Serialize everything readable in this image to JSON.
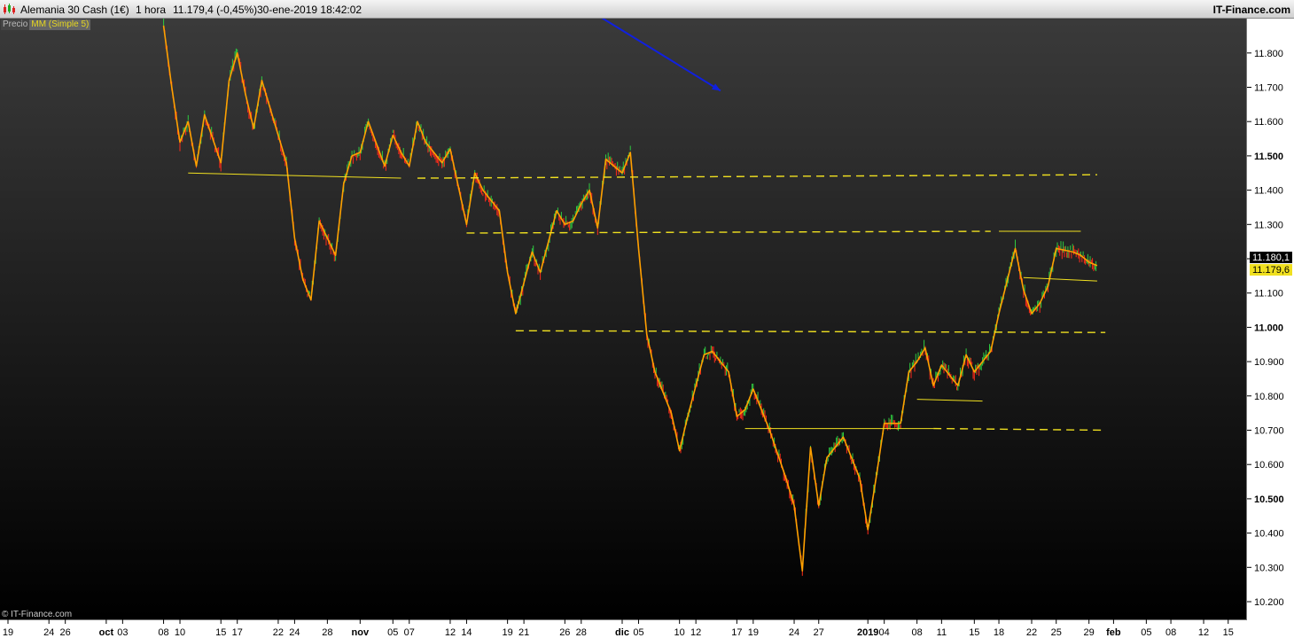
{
  "window": {
    "instrument": "Alemania 30 Cash (1€)",
    "timeframe": "1 hora",
    "last_change": "11.179,4 (-0,45%)",
    "datetime": "30-ene-2019 18:42:02",
    "brand": "IT-Finance.com"
  },
  "legend": {
    "price_label": "Precio",
    "ma_label": "MM (Simple 5)"
  },
  "copyright": "© IT-Finance.com",
  "colors": {
    "up": "#2ecc40",
    "down": "#ff2a1a",
    "ma": "#ffa000",
    "level": "#f0e020",
    "arrow": "#1020e0"
  },
  "chart_data": {
    "type": "line",
    "instrument": "Alemania 30 Cash (1€)",
    "interval": "1 hora",
    "ylim": [
      10170,
      11910
    ],
    "y_ticks": [
      10200,
      10300,
      10400,
      10500,
      10600,
      10700,
      10800,
      10900,
      11000,
      11100,
      11200,
      11300,
      11400,
      11500,
      11600,
      11700,
      11800
    ],
    "y_tick_labels": [
      "10.200",
      "10.300",
      "10.400",
      "10.500",
      "10.600",
      "10.700",
      "10.800",
      "10.900",
      "11.000",
      "11.100",
      "11.200",
      "11.300",
      "11.400",
      "11.500",
      "11.600",
      "11.700",
      "11.800"
    ],
    "y_major_ticks": [
      "10.500",
      "11.000",
      "11.500"
    ],
    "x_range": [
      "2018-09-19",
      "2019-02-16"
    ],
    "x_tick_labels": [
      {
        "date": "2018-09-19",
        "label": "19"
      },
      {
        "date": "2018-09-24",
        "label": "24"
      },
      {
        "date": "2018-09-26",
        "label": "26"
      },
      {
        "date": "2018-10-01",
        "label": "oct"
      },
      {
        "date": "2018-10-03",
        "label": "03"
      },
      {
        "date": "2018-10-08",
        "label": "08"
      },
      {
        "date": "2018-10-10",
        "label": "10"
      },
      {
        "date": "2018-10-15",
        "label": "15"
      },
      {
        "date": "2018-10-17",
        "label": "17"
      },
      {
        "date": "2018-10-22",
        "label": "22"
      },
      {
        "date": "2018-10-24",
        "label": "24"
      },
      {
        "date": "2018-10-28",
        "label": "28"
      },
      {
        "date": "2018-11-01",
        "label": "nov"
      },
      {
        "date": "2018-11-05",
        "label": "05"
      },
      {
        "date": "2018-11-07",
        "label": "07"
      },
      {
        "date": "2018-11-12",
        "label": "12"
      },
      {
        "date": "2018-11-14",
        "label": "14"
      },
      {
        "date": "2018-11-19",
        "label": "19"
      },
      {
        "date": "2018-11-21",
        "label": "21"
      },
      {
        "date": "2018-11-26",
        "label": "26"
      },
      {
        "date": "2018-11-28",
        "label": "28"
      },
      {
        "date": "2018-12-03",
        "label": "dic"
      },
      {
        "date": "2018-12-05",
        "label": "05"
      },
      {
        "date": "2018-12-10",
        "label": "10"
      },
      {
        "date": "2018-12-12",
        "label": "12"
      },
      {
        "date": "2018-12-17",
        "label": "17"
      },
      {
        "date": "2018-12-19",
        "label": "19"
      },
      {
        "date": "2018-12-24",
        "label": "24"
      },
      {
        "date": "2018-12-27",
        "label": "27"
      },
      {
        "date": "2019-01-02",
        "label": "2019"
      },
      {
        "date": "2019-01-04",
        "label": "04"
      },
      {
        "date": "2019-01-08",
        "label": "08"
      },
      {
        "date": "2019-01-11",
        "label": "11"
      },
      {
        "date": "2019-01-15",
        "label": "15"
      },
      {
        "date": "2019-01-18",
        "label": "18"
      },
      {
        "date": "2019-01-22",
        "label": "22"
      },
      {
        "date": "2019-01-25",
        "label": "25"
      },
      {
        "date": "2019-01-29",
        "label": "29"
      },
      {
        "date": "2019-02-01",
        "label": "feb"
      },
      {
        "date": "2019-02-05",
        "label": "05"
      },
      {
        "date": "2019-02-08",
        "label": "08"
      },
      {
        "date": "2019-02-12",
        "label": "12"
      },
      {
        "date": "2019-02-15",
        "label": "15"
      }
    ],
    "series": [
      {
        "name": "MM (Simple 5)",
        "x": [
          "2018-10-08",
          "2018-10-09",
          "2018-10-10",
          "2018-10-11",
          "2018-10-12",
          "2018-10-13",
          "2018-10-15",
          "2018-10-16",
          "2018-10-17",
          "2018-10-18",
          "2018-10-19",
          "2018-10-20",
          "2018-10-22",
          "2018-10-23",
          "2018-10-24",
          "2018-10-25",
          "2018-10-26",
          "2018-10-27",
          "2018-10-29",
          "2018-10-30",
          "2018-10-31",
          "2018-11-01",
          "2018-11-02",
          "2018-11-04",
          "2018-11-05",
          "2018-11-06",
          "2018-11-07",
          "2018-11-08",
          "2018-11-09",
          "2018-11-11",
          "2018-11-12",
          "2018-11-13",
          "2018-11-14",
          "2018-11-15",
          "2018-11-16",
          "2018-11-18",
          "2018-11-19",
          "2018-11-20",
          "2018-11-21",
          "2018-11-22",
          "2018-11-23",
          "2018-11-25",
          "2018-11-26",
          "2018-11-27",
          "2018-11-28",
          "2018-11-29",
          "2018-11-30",
          "2018-12-01",
          "2018-12-03",
          "2018-12-04",
          "2018-12-05",
          "2018-12-06",
          "2018-12-07",
          "2018-12-09",
          "2018-12-10",
          "2018-12-11",
          "2018-12-12",
          "2018-12-13",
          "2018-12-14",
          "2018-12-16",
          "2018-12-17",
          "2018-12-18",
          "2018-12-19",
          "2018-12-20",
          "2018-12-21",
          "2018-12-23",
          "2018-12-24",
          "2018-12-25",
          "2018-12-26",
          "2018-12-27",
          "2018-12-28",
          "2018-12-30",
          "2019-01-01",
          "2019-01-02",
          "2019-01-03",
          "2019-01-04",
          "2019-01-06",
          "2019-01-07",
          "2019-01-08",
          "2019-01-09",
          "2019-01-10",
          "2019-01-11",
          "2019-01-13",
          "2019-01-14",
          "2019-01-15",
          "2019-01-16",
          "2019-01-17",
          "2019-01-18",
          "2019-01-20",
          "2019-01-21",
          "2019-01-22",
          "2019-01-23",
          "2019-01-24",
          "2019-01-25",
          "2019-01-27",
          "2019-01-28",
          "2019-01-29",
          "2019-01-30"
        ],
        "values": [
          11880,
          11700,
          11540,
          11600,
          11470,
          11620,
          11480,
          11720,
          11800,
          11680,
          11580,
          11720,
          11560,
          11480,
          11260,
          11140,
          11080,
          11310,
          11210,
          11420,
          11500,
          11510,
          11600,
          11470,
          11560,
          11510,
          11470,
          11600,
          11540,
          11480,
          11520,
          11410,
          11300,
          11450,
          11400,
          11340,
          11160,
          11040,
          11130,
          11220,
          11160,
          11340,
          11300,
          11310,
          11360,
          11400,
          11290,
          11490,
          11450,
          11510,
          11230,
          10980,
          10870,
          10750,
          10640,
          10740,
          10830,
          10920,
          10930,
          10870,
          10740,
          10760,
          10820,
          10760,
          10700,
          10560,
          10480,
          10290,
          10650,
          10480,
          10620,
          10680,
          10560,
          10410,
          10560,
          10720,
          10720,
          10870,
          10900,
          10940,
          10830,
          10890,
          10830,
          10920,
          10870,
          10900,
          10930,
          11040,
          11230,
          11110,
          11040,
          11070,
          11120,
          11230,
          11220,
          11210,
          11190,
          11180
        ]
      }
    ],
    "horizontal_levels": [
      11000,
      11280,
      10790,
      10705
    ],
    "trendlines": [
      {
        "kind": "solid",
        "from": [
          "2018-10-11",
          11450
        ],
        "to": [
          "2018-11-06",
          11435
        ]
      },
      {
        "kind": "dashed",
        "from": [
          "2018-11-08",
          11435
        ],
        "to": [
          "2019-01-30",
          11445
        ]
      },
      {
        "kind": "dashed",
        "from": [
          "2018-11-14",
          11275
        ],
        "to": [
          "2019-01-17",
          11280
        ]
      },
      {
        "kind": "dashed",
        "from": [
          "2018-11-20",
          10990
        ],
        "to": [
          "2019-01-31",
          10985
        ]
      },
      {
        "kind": "solid",
        "from": [
          "2018-12-18",
          10705
        ],
        "to": [
          "2019-01-10",
          10705
        ]
      },
      {
        "kind": "dashed",
        "from": [
          "2019-01-10",
          10705
        ],
        "to": [
          "2019-01-31",
          10700
        ]
      },
      {
        "kind": "solid",
        "from": [
          "2019-01-08",
          10790
        ],
        "to": [
          "2019-01-16",
          10785
        ]
      },
      {
        "kind": "solid",
        "from": [
          "2019-01-18",
          11280
        ],
        "to": [
          "2019-01-28",
          11280
        ]
      },
      {
        "kind": "solid",
        "from": [
          "2019-01-21",
          11145
        ],
        "to": [
          "2019-01-30",
          11135
        ]
      }
    ],
    "arrow": {
      "from": [
        "2018-11-30",
        11910
      ],
      "to": [
        "2018-12-15",
        11690
      ]
    },
    "price_tags": [
      "11.180,1",
      "11.179,6"
    ],
    "grid": false,
    "legend_position": "top-left"
  }
}
